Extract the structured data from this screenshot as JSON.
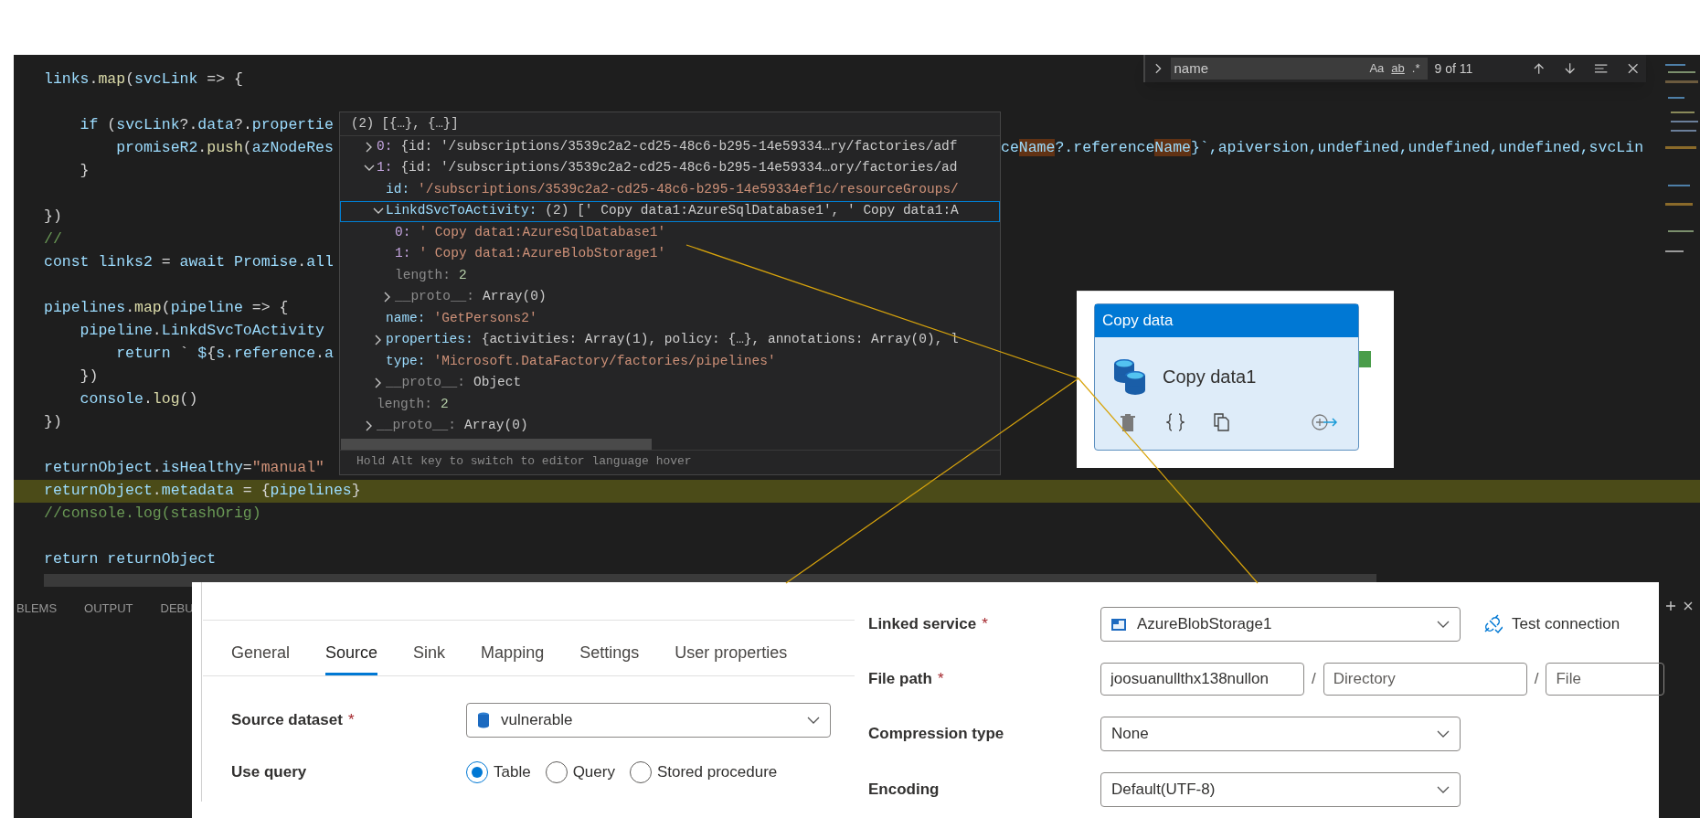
{
  "editor": {
    "lines": [
      {
        "kind": "code",
        "text": "links.map(svcLink => {",
        "highlighted": false
      },
      {
        "kind": "blank",
        "highlighted": false
      },
      {
        "kind": "code",
        "text": "    if (svcLink?.data?.propertie",
        "highlighted": false
      },
      {
        "kind": "code",
        "text": "        promiseR2.push(azNodeRes",
        "highlighted": false,
        "tail": [
          {
            "text": "ce",
            "match": false
          },
          {
            "text": "Name",
            "match": true
          },
          {
            "text": "?.reference",
            "match": false
          },
          {
            "text": "Name",
            "match": true
          },
          {
            "text": "}`,apiversion,undefined,undefined,undefined,svcLin",
            "match": false
          }
        ]
      },
      {
        "kind": "code",
        "text": "    }",
        "highlighted": false
      },
      {
        "kind": "blank",
        "highlighted": false
      },
      {
        "kind": "code",
        "text": "})",
        "highlighted": false
      },
      {
        "kind": "code",
        "text": "//",
        "highlighted": false
      },
      {
        "kind": "code",
        "text": "const links2 = await Promise.all",
        "highlighted": false
      },
      {
        "kind": "blank",
        "highlighted": false
      },
      {
        "kind": "code",
        "text": "pipelines.map(pipeline => {",
        "highlighted": false
      },
      {
        "kind": "code",
        "text": "    pipeline.LinkdSvcToActivity",
        "highlighted": false
      },
      {
        "kind": "code",
        "text": "        return ` ${s.reference.a",
        "highlighted": false
      },
      {
        "kind": "code",
        "text": "    })",
        "highlighted": false
      },
      {
        "kind": "code",
        "text": "    console.log()",
        "highlighted": false
      },
      {
        "kind": "code",
        "text": "})",
        "highlighted": false
      },
      {
        "kind": "blank",
        "highlighted": false
      },
      {
        "kind": "code",
        "text": "returnObject.isHealthy=\"manual\"",
        "highlighted": false
      },
      {
        "kind": "code",
        "text": "returnObject.metadata = {pipelines}",
        "highlighted": true
      },
      {
        "kind": "code",
        "text": "//console.log(stashOrig)",
        "highlighted": false
      },
      {
        "kind": "blank",
        "highlighted": false
      },
      {
        "kind": "code",
        "text": "return returnObject",
        "highlighted": false
      }
    ],
    "find": {
      "query": "name",
      "options": [
        "Aa",
        "ab",
        ".*"
      ],
      "count": "9 of 11"
    },
    "panel_tabs": [
      "BLEMS",
      "OUTPUT",
      "DEBU"
    ]
  },
  "hover": {
    "header": "(2) [{…}, {…}]",
    "nodes": [
      {
        "key": "0:",
        "value": "{id: '/subscriptions/3539c2a2-cd25-48c6-b295-14e59334…ry/factories/adf",
        "expanded": false,
        "selected": false
      },
      {
        "key": "1:",
        "value": "{id: '/subscriptions/3539c2a2-cd25-48c6-b295-14e59334…ory/factories/ad",
        "expanded": true,
        "selected": false,
        "children": [
          {
            "key": "id:",
            "value": "'/subscriptions/3539c2a2-cd25-48c6-b295-14e59334ef1c/resourceGroups/",
            "selected": false
          },
          {
            "key": "LinkdSvcToActivity:",
            "value": "(2) [' Copy data1:AzureSqlDatabase1', ' Copy data1:A",
            "expanded": true,
            "selected": true,
            "children": [
              {
                "key": "0:",
                "value": "' Copy data1:AzureSqlDatabase1'",
                "selected": false
              },
              {
                "key": "1:",
                "value": "' Copy data1:AzureBlobStorage1'",
                "selected": false
              },
              {
                "key": "length:",
                "value": "2",
                "dim": true,
                "selected": false
              },
              {
                "key": "__proto__:",
                "value": "Array(0)",
                "dim": true,
                "expanded": false,
                "selected": false
              }
            ]
          },
          {
            "key": "name:",
            "value": "'GetPersons2'",
            "selected": false
          },
          {
            "key": "properties:",
            "value": "{activities: Array(1), policy: {…}, annotations: Array(0), l",
            "expanded": false,
            "selected": false
          },
          {
            "key": "type:",
            "value": "'Microsoft.DataFactory/factories/pipelines'",
            "selected": false
          },
          {
            "key": "__proto__:",
            "value": "Object",
            "dim": true,
            "expanded": false,
            "selected": false
          }
        ]
      },
      {
        "key": "length:",
        "value": "2",
        "dim": true,
        "selected": false
      },
      {
        "key": "__proto__:",
        "value": "Array(0)",
        "dim": true,
        "expanded": false,
        "selected": false
      }
    ],
    "footer": "Hold Alt key to switch to editor language hover"
  },
  "activity": {
    "type": "Copy data",
    "name": "Copy data1"
  },
  "source_panel": {
    "tabs": [
      {
        "label": "General",
        "selected": false
      },
      {
        "label": "Source",
        "selected": true
      },
      {
        "label": "Sink",
        "selected": false
      },
      {
        "label": "Mapping",
        "selected": false
      },
      {
        "label": "Settings",
        "selected": false
      },
      {
        "label": "User properties",
        "selected": false
      }
    ],
    "fields": [
      {
        "kind": "dropdown",
        "label": "Source dataset",
        "marker": "*",
        "value": "vulnerable"
      },
      {
        "kind": "radio",
        "label": "Use query",
        "options": [
          {
            "label": "Table",
            "selected": true
          },
          {
            "label": "Query",
            "selected": false
          },
          {
            "label": "Stored procedure",
            "selected": false
          }
        ]
      }
    ]
  },
  "dataset_panel": {
    "fields": [
      {
        "kind": "dropdown",
        "label": "Linked service",
        "marker": "*",
        "value": "AzureBlobStorage1",
        "action": "Test connection"
      },
      {
        "kind": "path",
        "label": "File path",
        "marker": "*",
        "parts": [
          {
            "value": "joosuanullthx138nullon"
          },
          {
            "placeholder": "Directory"
          },
          {
            "placeholder": "File"
          }
        ],
        "separator": "/"
      },
      {
        "kind": "dropdown",
        "label": "Compression type",
        "value": "None"
      },
      {
        "kind": "dropdown",
        "label": "Encoding",
        "value": "Default(UTF-8)"
      }
    ]
  }
}
